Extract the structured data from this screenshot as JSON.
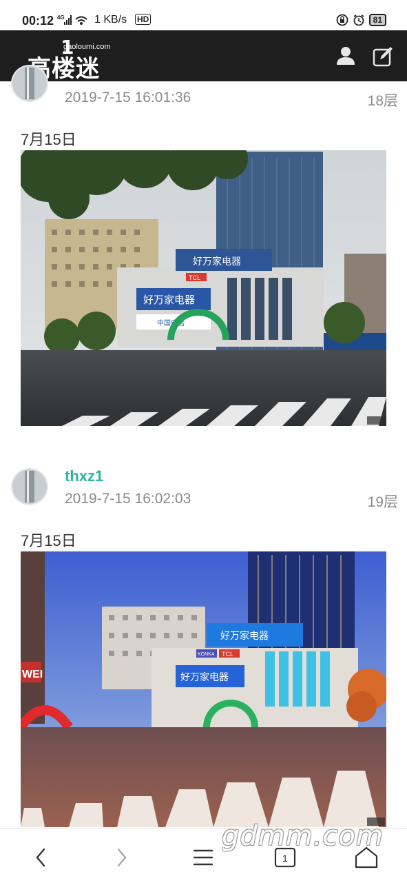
{
  "status": {
    "time": "00:12",
    "network": "4G",
    "speed": "1 KB/s",
    "hd": "HD",
    "battery": "81"
  },
  "header": {
    "logo_text": "高楼迷",
    "logo_domain": "gaoloumi.com",
    "logo_mark": "1"
  },
  "posts": [
    {
      "username": "",
      "datetime": "2019-7-15 16:01:36",
      "floor": "18层",
      "caption": "7月15日",
      "signs": {
        "main": "好万家电器",
        "top": "好万家电器",
        "tcl": "TCL",
        "telecom": "中国电信"
      }
    },
    {
      "username": "thxz1",
      "datetime": "2019-7-15 16:02:03",
      "floor": "19层",
      "caption": "7月15日",
      "signs": {
        "main": "好万家电器",
        "top": "好万家电器",
        "tcl": "TCL",
        "konka": "KONKA",
        "huawei": "WEI"
      }
    }
  ],
  "bottom_nav": {
    "tabs_count": "1"
  },
  "watermark": "gdmm.com",
  "colors": {
    "header_bg": "#1e1e1e",
    "username": "#2ab7a1",
    "meta": "#8a8a8a"
  }
}
